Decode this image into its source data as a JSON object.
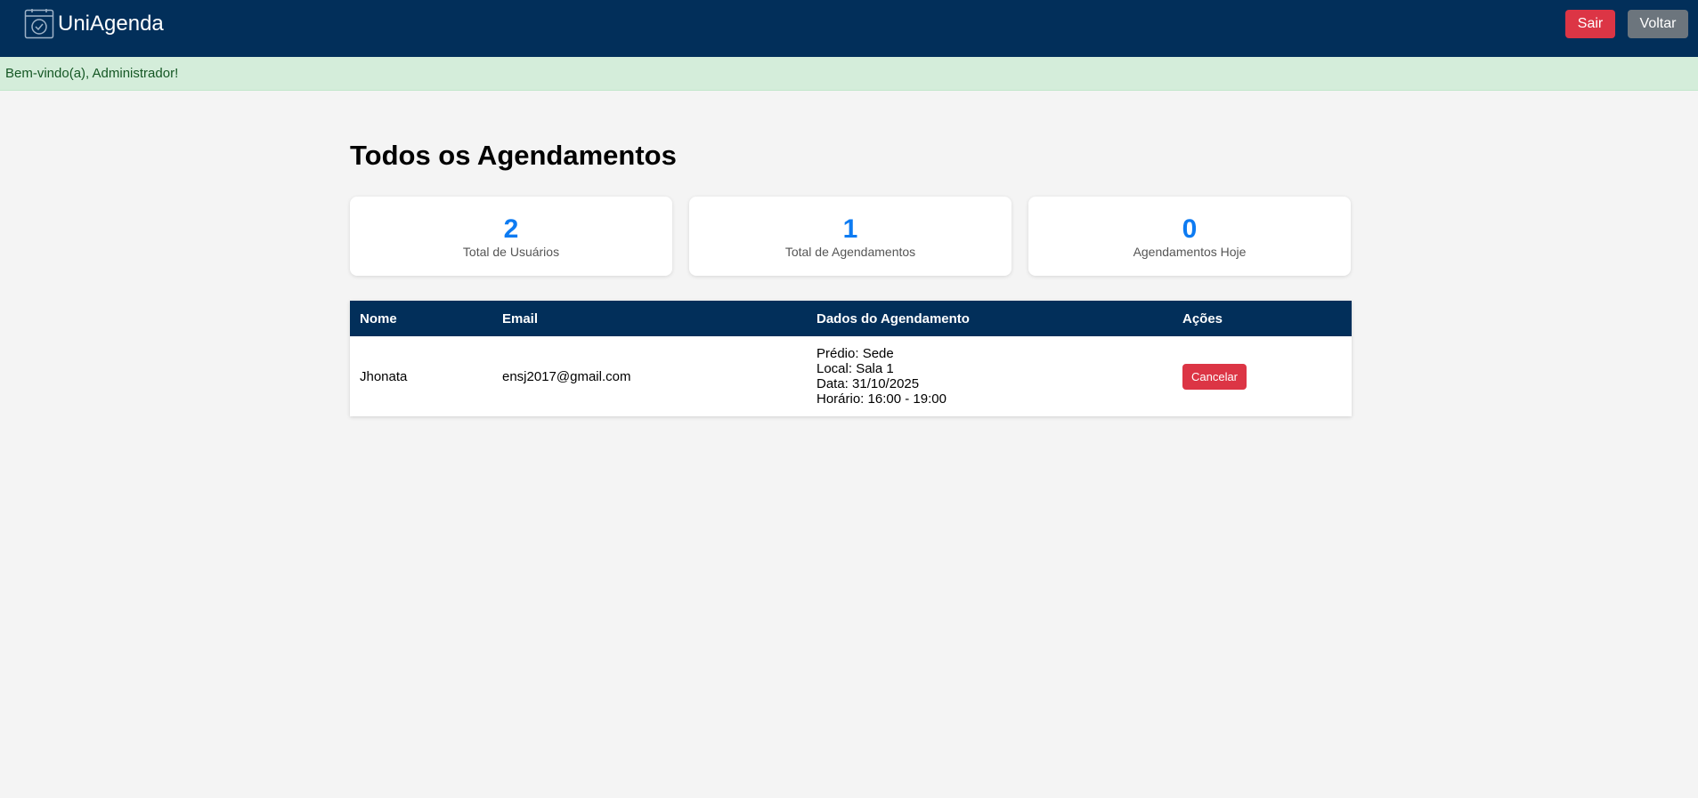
{
  "header": {
    "brand": "UniAgenda",
    "logout_label": "Sair",
    "back_label": "Voltar"
  },
  "welcome": {
    "message": "Bem-vindo(a), Administrador!"
  },
  "main": {
    "title": "Todos os Agendamentos",
    "stats": [
      {
        "value": "2",
        "label": "Total de Usuários"
      },
      {
        "value": "1",
        "label": "Total de Agendamentos"
      },
      {
        "value": "0",
        "label": "Agendamentos Hoje"
      }
    ],
    "table": {
      "columns": [
        "Nome",
        "Email",
        "Dados do Agendamento",
        "Ações"
      ],
      "rows": [
        {
          "nome": "Jhonata",
          "email": "ensj2017@gmail.com",
          "predio": "Prédio: Sede",
          "local": "Local: Sala 1",
          "data": "Data: 31/10/2025",
          "horario": "Horário: 16:00 - 19:00",
          "action_label": "Cancelar"
        }
      ]
    }
  },
  "colors": {
    "header_bg": "#022f5a",
    "welcome_bg": "#d4edda",
    "accent_blue": "#0d7bf2",
    "danger": "#dc3545",
    "secondary": "#6c757d"
  }
}
